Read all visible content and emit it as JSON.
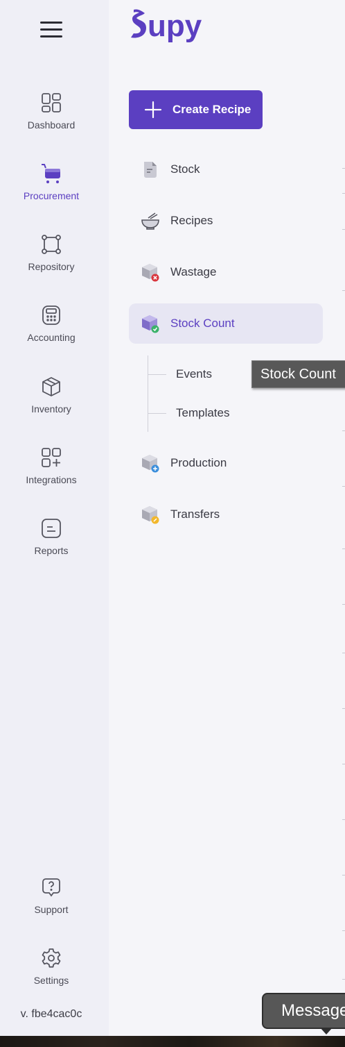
{
  "brand": {
    "logo_text": "Supy",
    "accent": "#5b3fc1"
  },
  "rail": {
    "items": [
      {
        "label": "Dashboard",
        "icon": "dashboard-icon"
      },
      {
        "label": "Procurement",
        "icon": "cart-icon",
        "active": true
      },
      {
        "label": "Repository",
        "icon": "repository-icon"
      },
      {
        "label": "Accounting",
        "icon": "calculator-icon"
      },
      {
        "label": "Inventory",
        "icon": "box-icon"
      },
      {
        "label": "Integrations",
        "icon": "integrations-icon"
      },
      {
        "label": "Reports",
        "icon": "report-icon"
      }
    ],
    "support": {
      "label": "Support",
      "icon": "help-icon"
    },
    "settings": {
      "label": "Settings",
      "icon": "gear-icon"
    },
    "version": "v. fbe4cac0c"
  },
  "panel": {
    "create_button": "Create Recipe",
    "nav": [
      {
        "label": "Stock",
        "icon": "document-icon"
      },
      {
        "label": "Recipes",
        "icon": "bowl-icon"
      },
      {
        "label": "Wastage",
        "icon": "wastage-box-icon"
      },
      {
        "label": "Stock Count",
        "icon": "stock-count-box-icon",
        "active": true
      },
      {
        "label": "Production",
        "icon": "production-box-icon"
      },
      {
        "label": "Transfers",
        "icon": "transfers-box-icon"
      }
    ],
    "sub_nav": [
      {
        "label": "Events"
      },
      {
        "label": "Templates"
      }
    ]
  },
  "tooltip": {
    "text": "Stock Count"
  },
  "messages_button": {
    "label": "Messages"
  }
}
